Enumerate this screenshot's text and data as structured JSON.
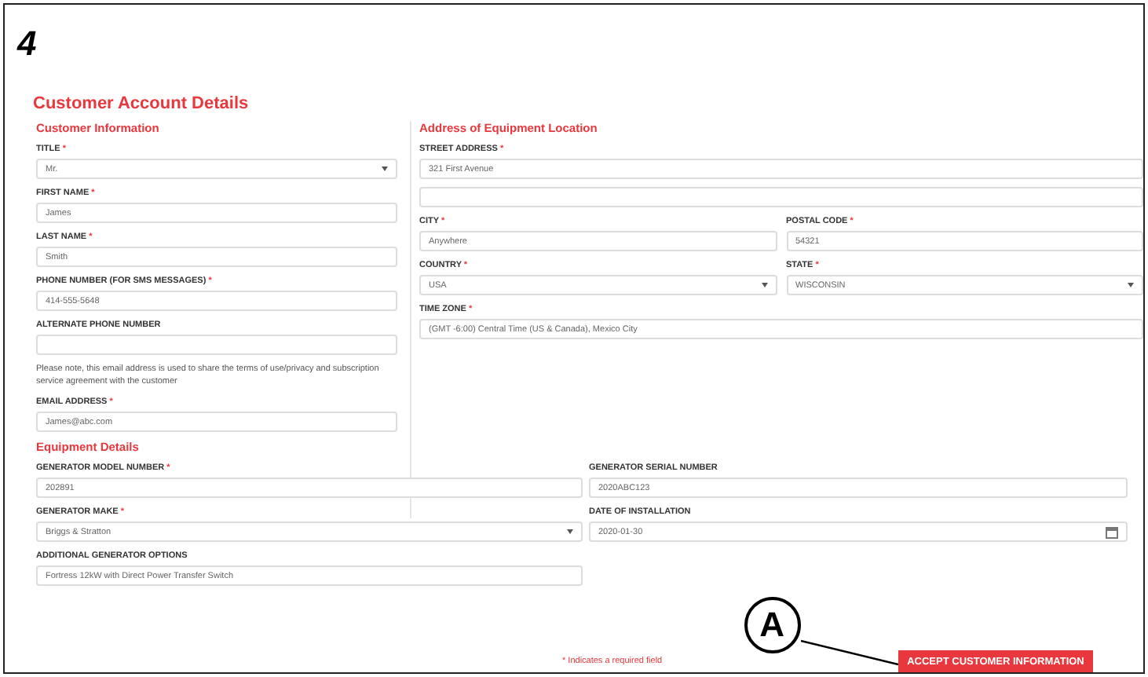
{
  "step": "4",
  "title": "Customer Account Details",
  "customer_information": {
    "heading": "Customer Information",
    "fields": [
      {
        "kind": "select",
        "label": "TITLE",
        "required_mark": "*",
        "value": "Mr."
      },
      {
        "kind": "text",
        "label": "FIRST NAME",
        "required_mark": "*",
        "value": "James"
      },
      {
        "kind": "text",
        "label": "LAST NAME",
        "required_mark": "*",
        "value": "Smith"
      },
      {
        "kind": "text",
        "label": "PHONE NUMBER (FOR SMS MESSAGES)",
        "required_mark": "*",
        "value": "414-555-5648"
      },
      {
        "kind": "text",
        "label": "ALTERNATE PHONE NUMBER"
      },
      {
        "kind": "note",
        "text": "Please note, this email address is used to share the terms of use/privacy and subscription service agreement with the customer"
      },
      {
        "kind": "text",
        "label": "EMAIL ADDRESS",
        "required_mark": "*",
        "value": "James@abc.com"
      }
    ]
  },
  "address": {
    "heading": "Address of Equipment Location",
    "rows": [
      [
        {
          "kind": "text",
          "label": "STREET ADDRESS",
          "required_mark": "*",
          "value": "321 First Avenue"
        }
      ],
      [
        {
          "kind": "text"
        }
      ],
      [
        {
          "kind": "text",
          "label": "CITY",
          "required_mark": "*",
          "value": "Anywhere"
        },
        {
          "kind": "text",
          "label": "POSTAL CODE",
          "required_mark": "*",
          "value": "54321"
        }
      ],
      [
        {
          "kind": "select",
          "label": "COUNTRY",
          "required_mark": "*",
          "value": "USA"
        },
        {
          "kind": "select",
          "label": "STATE",
          "required_mark": "*",
          "value": "WISCONSIN"
        }
      ],
      [
        {
          "kind": "text",
          "label": "TIME ZONE",
          "required_mark": "*",
          "value": "(GMT -6:00) Central Time (US & Canada), Mexico City"
        }
      ]
    ]
  },
  "equipment": {
    "heading": "Equipment Details",
    "columns": [
      [
        {
          "kind": "text",
          "label": "GENERATOR MODEL NUMBER",
          "required_mark": "*",
          "value": "202891"
        },
        {
          "kind": "select",
          "label": "GENERATOR MAKE",
          "required_mark": "*",
          "value": "Briggs & Stratton"
        },
        {
          "kind": "text",
          "label": "ADDITIONAL GENERATOR OPTIONS",
          "value": "Fortress 12kW with Direct Power Transfer Switch"
        }
      ],
      [
        {
          "kind": "text",
          "label": "GENERATOR SERIAL NUMBER",
          "value": "2020ABC123"
        },
        {
          "kind": "date",
          "label": "DATE OF INSTALLATION",
          "value": "2020-01-30"
        }
      ]
    ]
  },
  "footer": {
    "required_note": "* Indicates a required field",
    "callout": "A",
    "button": "ACCEPT CUSTOMER INFORMATION"
  }
}
